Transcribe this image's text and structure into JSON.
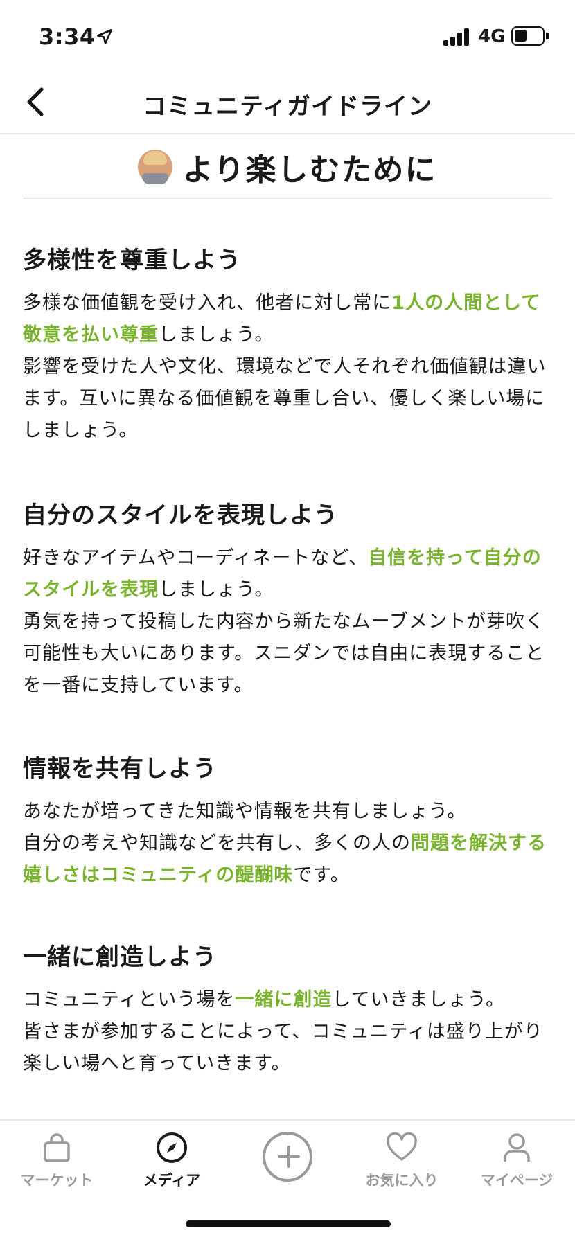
{
  "status_bar": {
    "time": "3:34",
    "network": "4G"
  },
  "nav": {
    "title": "コミュニティガイドライン"
  },
  "heading": {
    "title": "より楽しむために"
  },
  "sections": [
    {
      "title": "多様性を尊重しよう",
      "segments": [
        {
          "t": "多様な価値観を受け入れ、他者に対し常に",
          "hl": false
        },
        {
          "t": "1人の人間として敬意を払い尊重",
          "hl": true
        },
        {
          "t": "しましょう。\n影響を受けた人や文化、環境などで人それぞれ価値観は違います。互いに異なる価値観を尊重し合い、優しく楽しい場にしましょう。",
          "hl": false
        }
      ]
    },
    {
      "title": "自分のスタイルを表現しよう",
      "segments": [
        {
          "t": "好きなアイテムやコーディネートなど、",
          "hl": false
        },
        {
          "t": "自信を持って自分のスタイルを表現",
          "hl": true
        },
        {
          "t": "しましょう。\n勇気を持って投稿した内容から新たなムーブメントが芽吹く可能性も大いにあります。スニダンでは自由に表現することを一番に支持しています。",
          "hl": false
        }
      ]
    },
    {
      "title": "情報を共有しよう",
      "segments": [
        {
          "t": "あなたが培ってきた知識や情報を共有しましょう。\n自分の考えや知識などを共有し、多くの人の",
          "hl": false
        },
        {
          "t": "問題を解決する嬉しさはコミュニティの醍醐味",
          "hl": true
        },
        {
          "t": "です。",
          "hl": false
        }
      ]
    },
    {
      "title": "一緒に創造しよう",
      "segments": [
        {
          "t": "コミュニティという場を",
          "hl": false
        },
        {
          "t": "一緒に創造",
          "hl": true
        },
        {
          "t": "していきましょう。\n皆さまが参加することによって、コミュニティは盛り上がり楽しい場へと育っていきます。",
          "hl": false
        }
      ]
    }
  ],
  "tabs": [
    {
      "label": "マーケット",
      "icon": "bag-icon",
      "active": false
    },
    {
      "label": "メディア",
      "icon": "compass-icon",
      "active": true
    },
    {
      "label": "",
      "icon": "plus-circle-icon",
      "active": false
    },
    {
      "label": "お気に入り",
      "icon": "heart-icon",
      "active": false
    },
    {
      "label": "マイページ",
      "icon": "person-icon",
      "active": false
    }
  ],
  "colors": {
    "accent_green": "#7ab32e",
    "text": "#1a1a1a",
    "inactive_gray": "#9a9a9a"
  }
}
